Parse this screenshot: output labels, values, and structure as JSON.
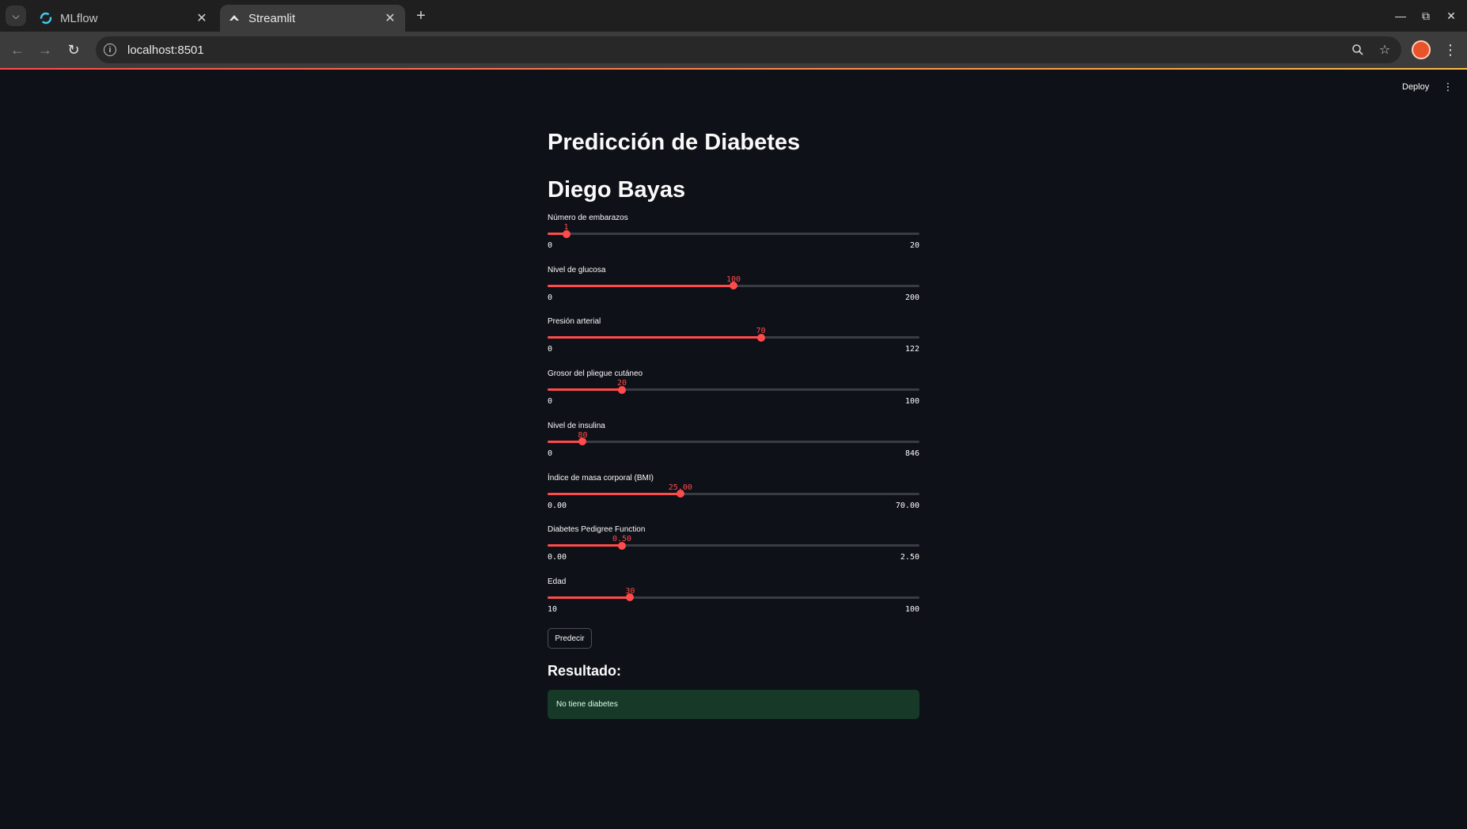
{
  "browser": {
    "tabs": [
      {
        "title": "MLflow",
        "active": false,
        "icon": "mlflow-icon"
      },
      {
        "title": "Streamlit",
        "active": true,
        "icon": "streamlit-icon"
      }
    ],
    "url": "localhost:8501"
  },
  "app": {
    "deploy_label": "Deploy",
    "title": "Predicción de Diabetes",
    "subtitle": "Diego Bayas",
    "sliders": [
      {
        "label": "Número de embarazos",
        "value": "1",
        "min": "0",
        "max": "20",
        "frac": 0.05
      },
      {
        "label": "Nivel de glucosa",
        "value": "100",
        "min": "0",
        "max": "200",
        "frac": 0.5
      },
      {
        "label": "Presión arterial",
        "value": "70",
        "min": "0",
        "max": "122",
        "frac": 0.5738
      },
      {
        "label": "Grosor del pliegue cutáneo",
        "value": "20",
        "min": "0",
        "max": "100",
        "frac": 0.2
      },
      {
        "label": "Nivel de insulina",
        "value": "80",
        "min": "0",
        "max": "846",
        "frac": 0.0946
      },
      {
        "label": "Índice de masa corporal (BMI)",
        "value": "25.00",
        "min": "0.00",
        "max": "70.00",
        "frac": 0.3571
      },
      {
        "label": "Diabetes Pedigree Function",
        "value": "0.50",
        "min": "0.00",
        "max": "2.50",
        "frac": 0.2
      },
      {
        "label": "Edad",
        "value": "30",
        "min": "10",
        "max": "100",
        "frac": 0.2222
      }
    ],
    "predict_label": "Predecir",
    "result_title": "Resultado:",
    "result_message": "No tiene diabetes"
  },
  "colors": {
    "accent": "#ff4b4b",
    "background": "#0e1117",
    "success_bg": "#173928"
  }
}
